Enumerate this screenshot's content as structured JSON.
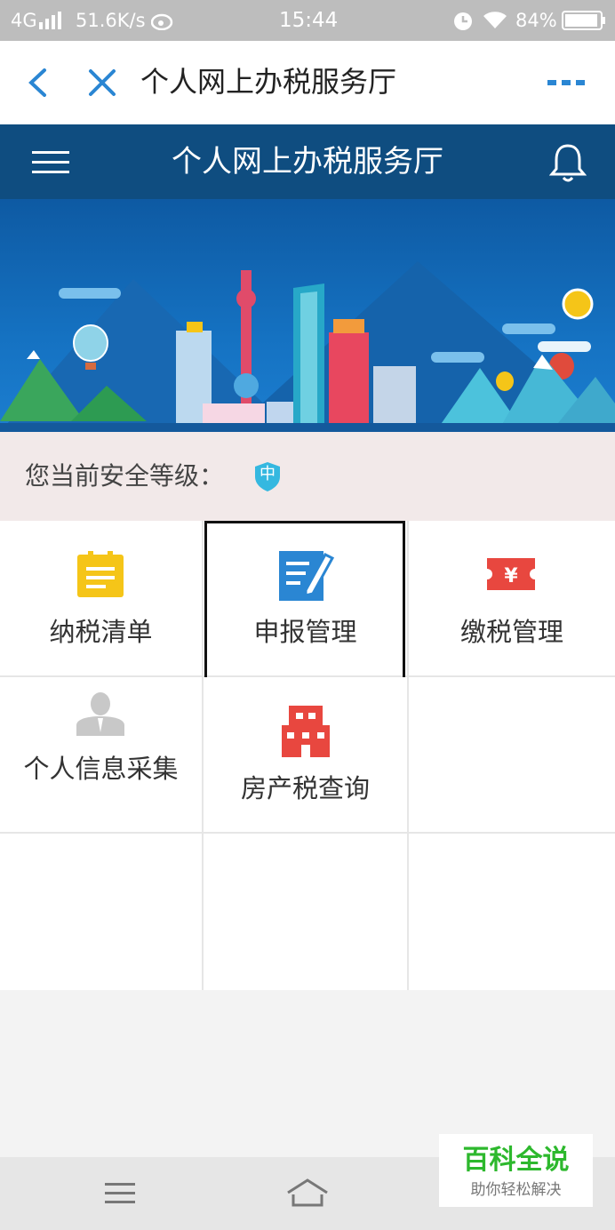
{
  "status_bar": {
    "network": "4G",
    "speed": "51.6K/s",
    "time": "15:44",
    "battery": "84%",
    "icons": [
      "signal-icon",
      "weibo-icon",
      "alarm-icon",
      "wifi-icon",
      "battery-icon"
    ]
  },
  "webview": {
    "title": "个人网上办税服务厅",
    "icons": [
      "back-icon",
      "close-icon",
      "more-icon"
    ],
    "accent_color": "#2a86d3"
  },
  "app_header": {
    "title": "个人网上办税服务厅",
    "icons": [
      "menu-icon",
      "bell-icon"
    ],
    "color": "#0f4d80"
  },
  "security": {
    "label": "您当前安全等级：",
    "level": "中",
    "badge_color": "#35b8e0"
  },
  "grid": {
    "items": [
      {
        "label": "纳税清单",
        "icon": "tax-list-icon",
        "color": "#f5c518"
      },
      {
        "label": "申报管理",
        "icon": "declare-edit-icon",
        "color": "#2a86d3"
      },
      {
        "label": "缴税管理",
        "icon": "yen-ticket-icon",
        "color": "#e8473f"
      },
      {
        "label": "个人信息采集",
        "icon": "person-icon",
        "color": "#c8c8c8"
      },
      {
        "label": "房产税查询",
        "icon": "building-icon",
        "color": "#e8473f"
      }
    ]
  },
  "watermark": {
    "title": "百科全说",
    "subtitle": "助你轻松解决"
  },
  "nav": {
    "icons": [
      "menu-lines-icon",
      "home-icon"
    ]
  }
}
